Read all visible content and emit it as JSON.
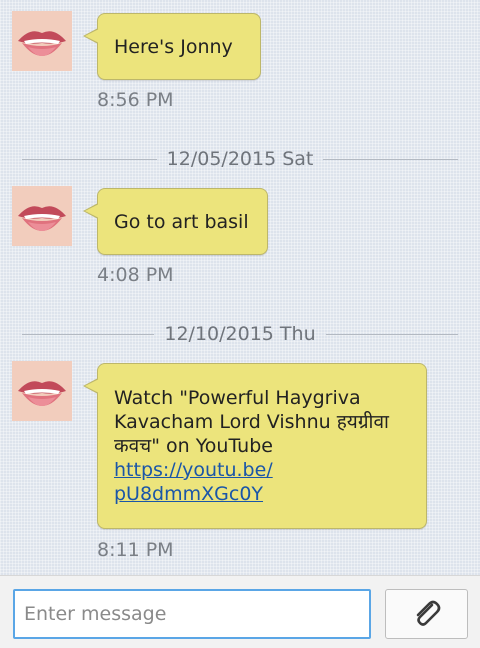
{
  "messages": [
    {
      "text": "Here's Jonny",
      "time": "8:56 PM"
    },
    {
      "date": "12/05/2015 Sat",
      "text": "Go to art basil",
      "time": "4:08 PM"
    },
    {
      "date": "12/10/2015 Thu",
      "text_lines": [
        "Watch \"Powerful Haygriva",
        "Kavacham Lord Vishnu हयग्रीवा",
        "कवच\" on YouTube"
      ],
      "link_lines": [
        "https://youtu.be/",
        "pU8dmmXGc0Y"
      ],
      "time": "8:11 PM"
    }
  ],
  "composer": {
    "placeholder": "Enter message",
    "attach_icon": "paperclip-icon"
  },
  "colors": {
    "bubble": "#ece47c",
    "link": "#1a56a8",
    "input_border": "#5aa6e6"
  }
}
